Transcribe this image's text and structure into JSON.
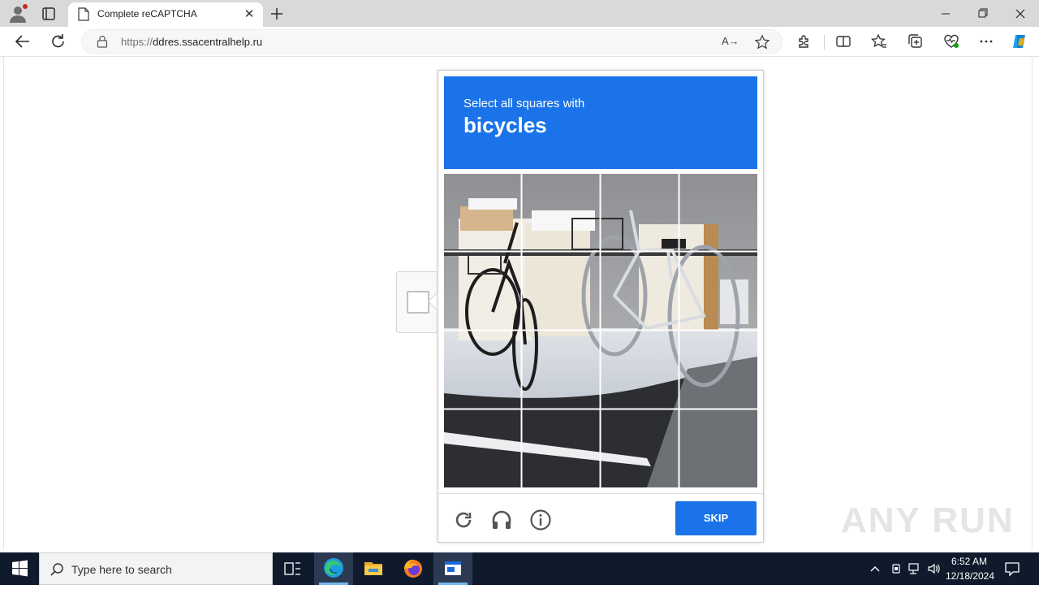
{
  "browser": {
    "tab": {
      "title": "Complete reCAPTCHA",
      "close_glyph": "✕"
    },
    "address": {
      "scheme": "https://",
      "host": "ddres.ssacentralhelp.ru"
    },
    "read_aloud_label": "A→"
  },
  "captcha": {
    "prompt": "Select all squares with",
    "target_object": "bicycles",
    "grid_size": 4,
    "skip_label": "SKIP",
    "header_color": "#1a73e8"
  },
  "watermark": {
    "text": "ANY RUN"
  },
  "taskbar": {
    "search_placeholder": "Type here to search",
    "clock_time": "6:52 AM",
    "clock_date": "12/18/2024"
  },
  "icons": {
    "profile": "person-avatar-icon",
    "tab_actions": "tab-actions-icon",
    "page": "page-icon",
    "new_tab": "plus-icon",
    "back": "back-arrow-icon",
    "reload": "reload-icon",
    "lock": "lock-icon",
    "favorite": "star-icon",
    "captcha_reload": "reload-icon",
    "captcha_audio": "headphones-icon",
    "captcha_info": "info-icon"
  }
}
